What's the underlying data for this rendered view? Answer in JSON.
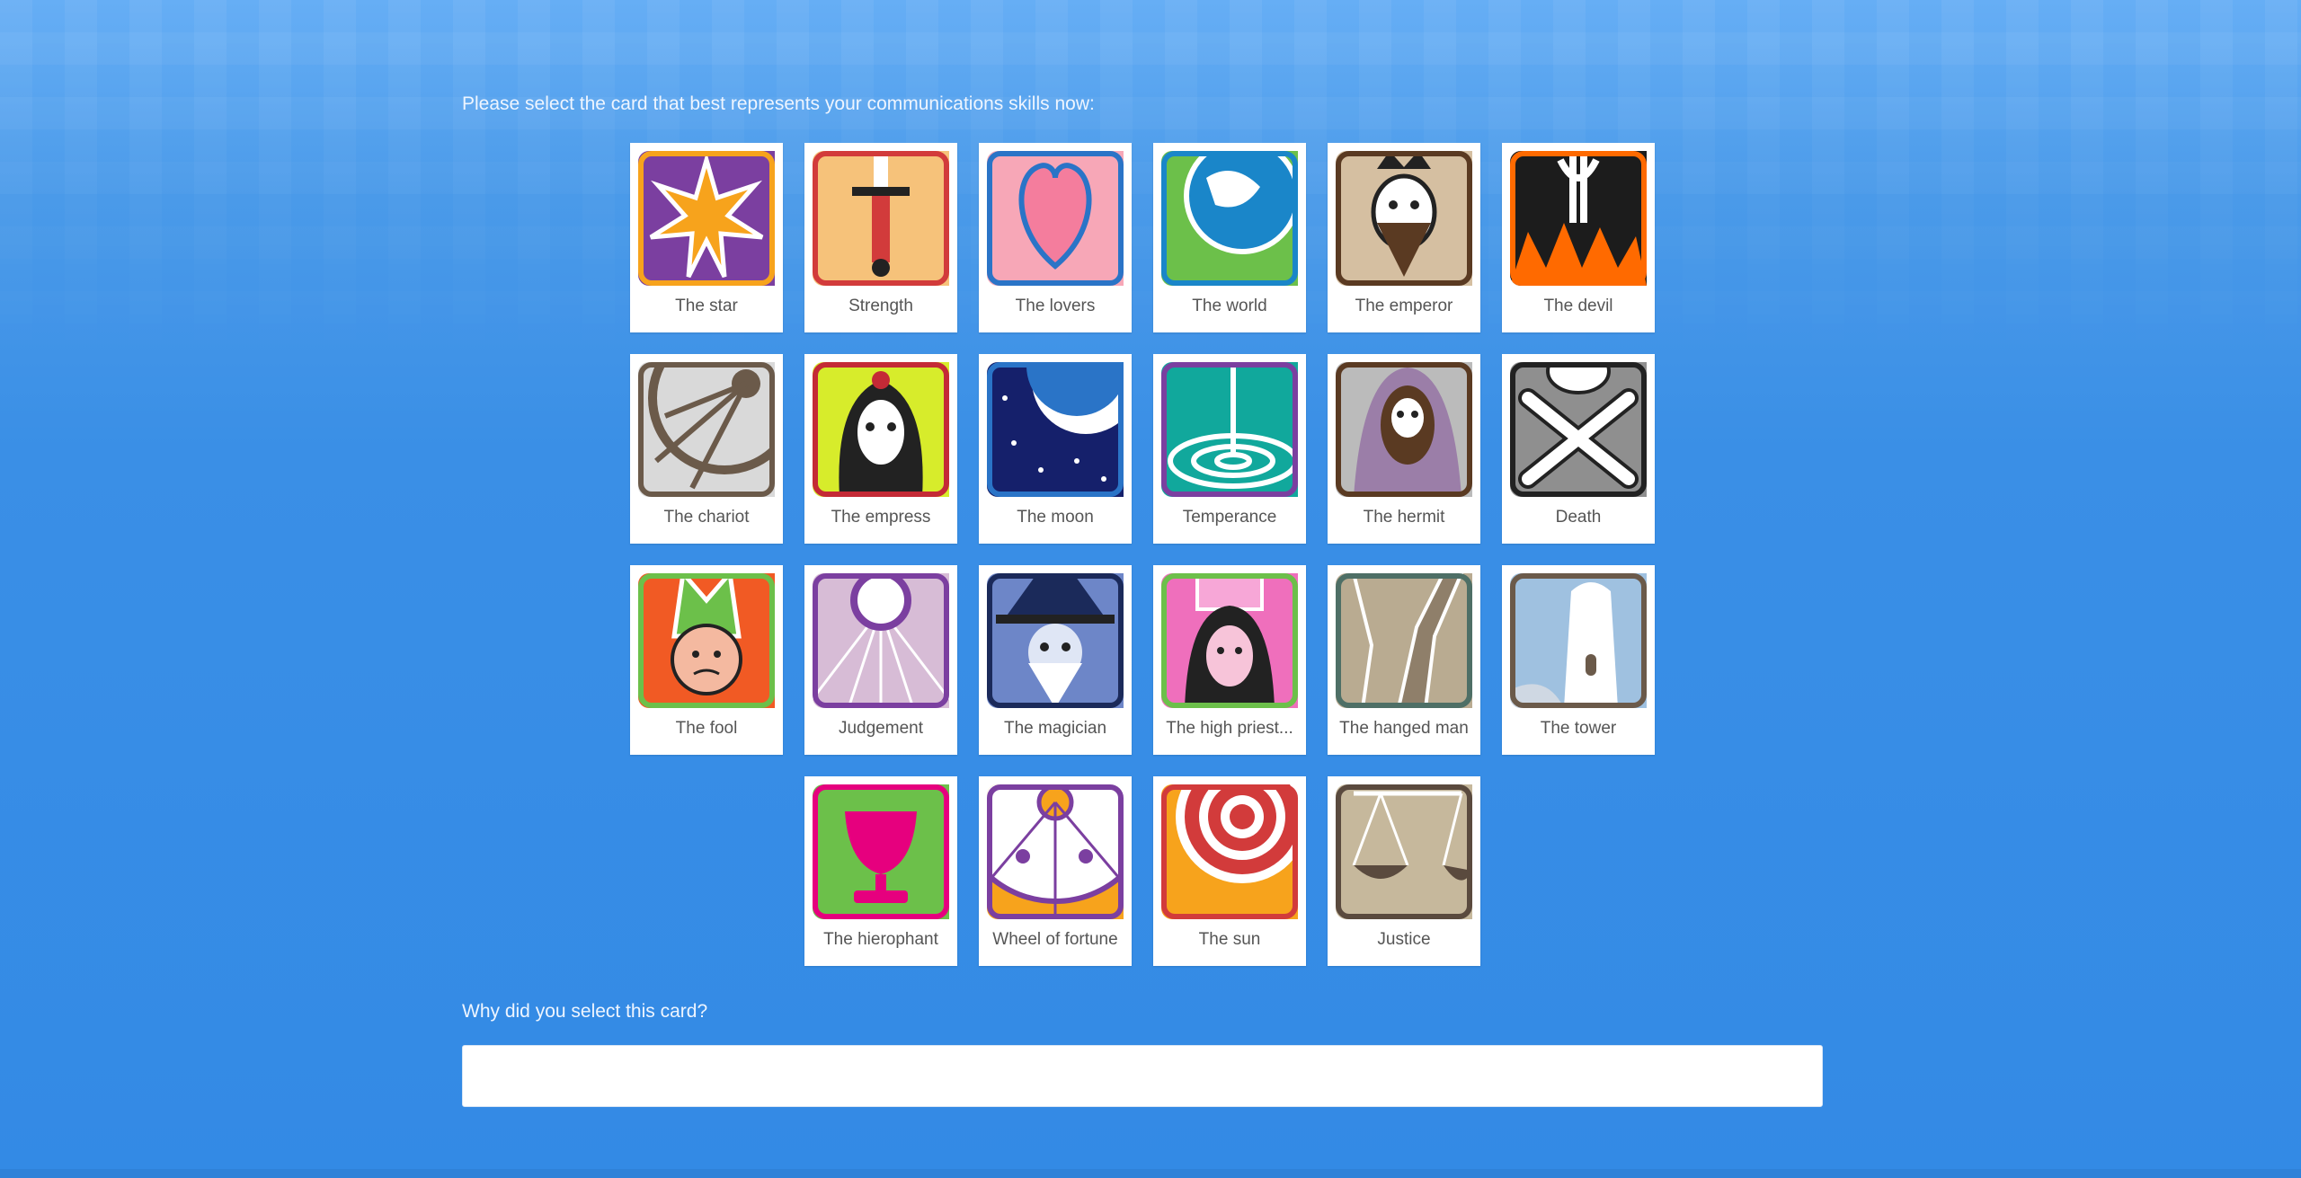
{
  "prompt": "Please select the card that best represents your communications skills now:",
  "cards": [
    {
      "label": "The star",
      "icon": "star-card-icon",
      "colors": [
        "#7b3fa0",
        "#f7a31c"
      ]
    },
    {
      "label": "Strength",
      "icon": "sword-card-icon",
      "colors": [
        "#f6c27a",
        "#d23b3b"
      ]
    },
    {
      "label": "The lovers",
      "icon": "heart-card-icon",
      "colors": [
        "#f7a7b7",
        "#2a74c7"
      ]
    },
    {
      "label": "The world",
      "icon": "globe-card-icon",
      "colors": [
        "#6cc04a",
        "#1a86c9"
      ]
    },
    {
      "label": "The emperor",
      "icon": "emperor-card-icon",
      "colors": [
        "#d5bfa1",
        "#5a3a22"
      ]
    },
    {
      "label": "The devil",
      "icon": "devil-card-icon",
      "colors": [
        "#1c1c1c",
        "#ff6a00"
      ]
    },
    {
      "label": "The chariot",
      "icon": "wheel-card-icon",
      "colors": [
        "#d9d9d9",
        "#6b5a4a"
      ]
    },
    {
      "label": "The empress",
      "icon": "empress-card-icon",
      "colors": [
        "#d7ec2b",
        "#c42a36"
      ]
    },
    {
      "label": "The moon",
      "icon": "moon-card-icon",
      "colors": [
        "#15206b",
        "#2a74c7"
      ]
    },
    {
      "label": "Temperance",
      "icon": "water-card-icon",
      "colors": [
        "#11a89c",
        "#7b3fa0"
      ]
    },
    {
      "label": "The hermit",
      "icon": "hermit-card-icon",
      "colors": [
        "#9b7ea8",
        "#5a3a22"
      ]
    },
    {
      "label": "Death",
      "icon": "skull-card-icon",
      "colors": [
        "#8f8f8f",
        "#222222"
      ]
    },
    {
      "label": "The fool",
      "icon": "fool-card-icon",
      "colors": [
        "#f15a24",
        "#6cc04a"
      ]
    },
    {
      "label": "Judgement",
      "icon": "sun-rays-card-icon",
      "colors": [
        "#d7bcd6",
        "#7b3fa0"
      ]
    },
    {
      "label": "The magician",
      "icon": "wizard-card-icon",
      "colors": [
        "#6d86c8",
        "#1b2a5a"
      ]
    },
    {
      "label": "The high priest...",
      "icon": "priestess-card-icon",
      "colors": [
        "#ef6fbc",
        "#6cc04a"
      ]
    },
    {
      "label": "The hanged man",
      "icon": "tree-card-icon",
      "colors": [
        "#b9ab91",
        "#4e6f66"
      ]
    },
    {
      "label": "The tower",
      "icon": "tower-card-icon",
      "colors": [
        "#9fc1e0",
        "#6b5a4a"
      ]
    },
    {
      "label": "The hierophant",
      "icon": "cup-card-icon",
      "colors": [
        "#6cc04a",
        "#e6007e"
      ]
    },
    {
      "label": "Wheel of fortune",
      "icon": "fortune-card-icon",
      "colors": [
        "#f7a31c",
        "#7b3fa0"
      ]
    },
    {
      "label": "The sun",
      "icon": "sun-card-icon",
      "colors": [
        "#f7a31c",
        "#d23b3b"
      ]
    },
    {
      "label": "Justice",
      "icon": "scales-card-icon",
      "colors": [
        "#c6b89c",
        "#5a4a3e"
      ]
    }
  ],
  "follow_up": "Why did you select this card?",
  "answer": {
    "value": "",
    "placeholder": ""
  }
}
